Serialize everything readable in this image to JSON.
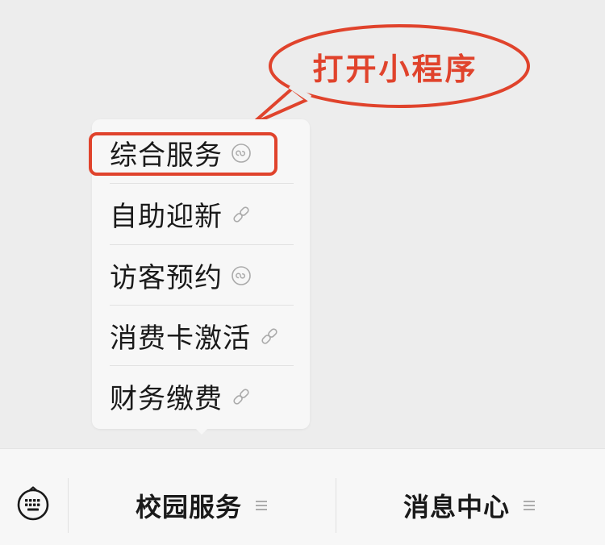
{
  "callout": {
    "text": "打开小程序",
    "color": "#e0432c"
  },
  "submenu": {
    "items": [
      {
        "label": "综合服务",
        "icon": "mini-program-icon",
        "highlighted": true
      },
      {
        "label": "自助迎新",
        "icon": "link-icon",
        "highlighted": false
      },
      {
        "label": "访客预约",
        "icon": "mini-program-icon",
        "highlighted": false
      },
      {
        "label": "消费卡激活",
        "icon": "link-icon",
        "highlighted": false
      },
      {
        "label": "财务缴费",
        "icon": "link-icon",
        "highlighted": false
      }
    ]
  },
  "bottom_bar": {
    "keyboard_icon": "keyboard-icon",
    "tabs": [
      {
        "label": "校园服务",
        "icon": "menu-lines-icon"
      },
      {
        "label": "消息中心",
        "icon": "menu-lines-icon"
      }
    ]
  }
}
